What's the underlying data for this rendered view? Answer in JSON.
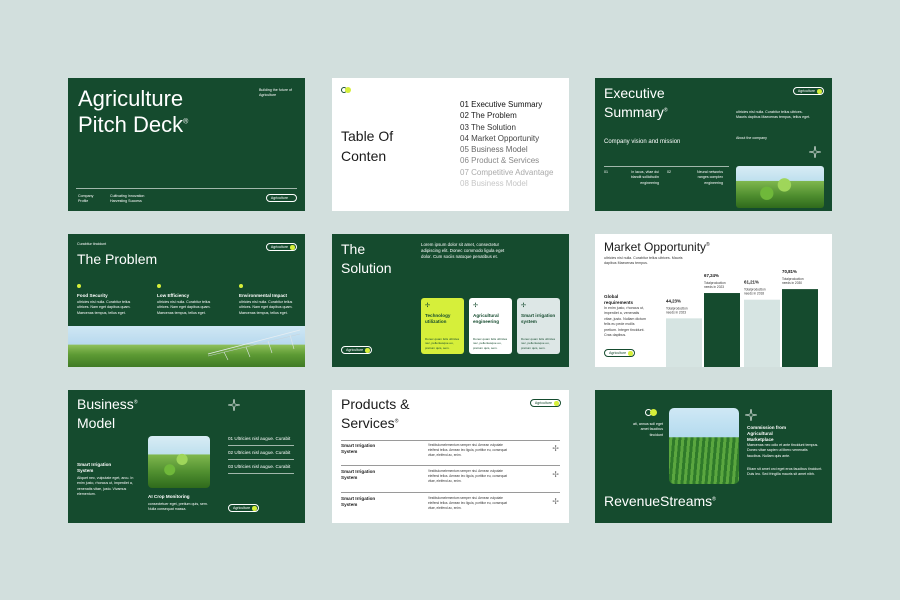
{
  "colors": {
    "background": "#d2dfdd",
    "green": "#154b2e",
    "accent": "#d6ef3a",
    "white": "#ffffff"
  },
  "s1": {
    "title_line1": "Agriculture",
    "title_line2": "Pitch Deck",
    "reg": "®",
    "tagline": "Building the future of Agriculture",
    "footer_left": "Company Profile",
    "footer_mid": "Cultivating Innovation Harvesting Success",
    "pill": "Agriculture"
  },
  "s2": {
    "title_line1": "Table Of",
    "title_line2": "Conten",
    "items": [
      "01 Executive Summary",
      "02 The Problem",
      "03 The Solution",
      "04 Market Opportunity",
      "05 Business Model",
      "06 Product & Services",
      "07 Competitive Advantage",
      "08 Business Model"
    ]
  },
  "s3": {
    "title_line1": "Executive",
    "title_line2": "Summary",
    "reg": "®",
    "pill": "Agriculture",
    "right_text": "ultricies nisl nulla. Curabitur tellus ultrices. Mauris dapibus Maecenas tempus, tellus eget.",
    "subtitle": "Company vision and mission",
    "about": "About the company",
    "col1_num": "01",
    "col1_text": "In lacus, vitae dui blandit sollicitudin engineering",
    "col2_num": "02",
    "col2_text": "Neural networks ranges complex engineering"
  },
  "s4": {
    "label": "Curabitur tincidunt",
    "title": "The Problem",
    "pill": "Agriculture",
    "cols": [
      {
        "title": "Food Security",
        "text": "ultricies nisl nulla. Curabitur tellus ultrices. Nam eget dapibus quam. Maecenas tempus, tellus eget."
      },
      {
        "title": "Low Efficiency",
        "text": "ultricies nisl nulla. Curabitur tellus ultrices. Nam eget dapibus quam. Maecenas tempus, tellus eget."
      },
      {
        "title": "Environmental Impact",
        "text": "ultricies nisl nulla. Curabitur tellus ultrices. Nam eget dapibus quam. Maecenas tempus, tellus eget."
      }
    ]
  },
  "s5": {
    "title_line1": "The",
    "title_line2": "Solution",
    "intro": "Lorem ipsum dolor sit amet, consectetur adipiscing elit. Donec commodo ligula eget dolor. Cum sociis natoque penatibus et.",
    "pill": "Agriculture",
    "cards": [
      {
        "title": "Technology utilization",
        "text": "Donec quam felis ultricies nec, pellentesque eu, pretium quis, sem."
      },
      {
        "title": "Agricultural engineering",
        "text": "Donec quam felis ultricies nec, pellentesque eu, pretium quis, sem."
      },
      {
        "title": "Smart irrigation system",
        "text": "Donec quam felis ultricies nec, pellentesque eu, pretium quis, sem."
      }
    ]
  },
  "s6": {
    "title": "Market Opportunity",
    "reg": "®",
    "subtitle": "ultricies nisl nulla. Curabitur tellus ultrices. Mauris dapibus Maecenas tempus.",
    "global": "Global requirements",
    "global_text": "In enim justo, rhoncus ut, imperdiet a, venenatis vitae, justo. Nullam dictum felis eu pede mollis pretium. Integer tincidunt. Cras dapibus.",
    "pill": "Agriculture"
  },
  "s7": {
    "title_line1": "Business",
    "title_line2": "Model",
    "reg": "®",
    "items": [
      "01 Ultricies nisl augue. Curabit",
      "02 Ultricies nisl augue. Curabit",
      "03 Ultricies nisl augue. Curabit"
    ],
    "left_title": "Smart Irrigation System",
    "left_text": "Aliquet nec, vulputate eget, arcu. In enim justo, rhoncus ut, imperdiet a, venenatis vitae, justo. Vivamus elementum.",
    "bottom_title": "AI Crop Monitoring",
    "bottom_text": "consectetuer eget, pretium quis, sem. Nulla consequat massa.",
    "pill": "Agriculture"
  },
  "s8": {
    "title_line1": "Products &",
    "title_line2": "Services",
    "reg": "®",
    "pill": "Agriculture",
    "rows": [
      {
        "title": "Smart Irrigation System",
        "text": "Vestibulumelementum semper nisi. Aenean vulputate eleifend tellus. Aenean leo ligula, porttitor eu, consequat vitae, eleifend ac, enim."
      },
      {
        "title": "Smart Irrigation System",
        "text": "Vestibulumelementum semper nisi. Aenean vulputate eleifend tellus. Aenean leo ligula, porttitor eu, consequat vitae, eleifend ac, enim."
      },
      {
        "title": "Smart Irrigation System",
        "text": "Vestibulumelementum semper nisi. Aenean vulputate eleifend tellus. Aenean leo ligula, porttitor eu, consequat vitae, eleifend ac, enim."
      }
    ]
  },
  "s9": {
    "small_text": "ati, annus soll eget amet faucibus tincidunt",
    "right_title": "Commission from Agricultural Marketplace",
    "right_text1": "Maecenas nec odio et ante tincidunt tempus. Donec vitae sapien ut libero venenatis faucibus. Nullam quis ante.",
    "right_text2": "Etiam sit amet orci eget eros faucibus tincidunt. Duis leo. Sed fringilla mauris sit amet nibh.",
    "title": "RevenueStreams",
    "reg": "®"
  },
  "chart_data": {
    "type": "bar",
    "categories": [
      "Totalproduction needs in 2023",
      "Totalproduction needs in 2023",
      "Totalproduction needs in 2018",
      "Totalproduction needs in 2030"
    ],
    "values": [
      44.23,
      67.24,
      61.21,
      70.81
    ],
    "labels": [
      "44,23%",
      "67,24%",
      "61,21%",
      "70,81%"
    ],
    "colors": [
      "#d6e4e2",
      "#154b2e",
      "#d6e4e2",
      "#154b2e"
    ],
    "ylim": [
      0,
      100
    ],
    "grid": false
  }
}
